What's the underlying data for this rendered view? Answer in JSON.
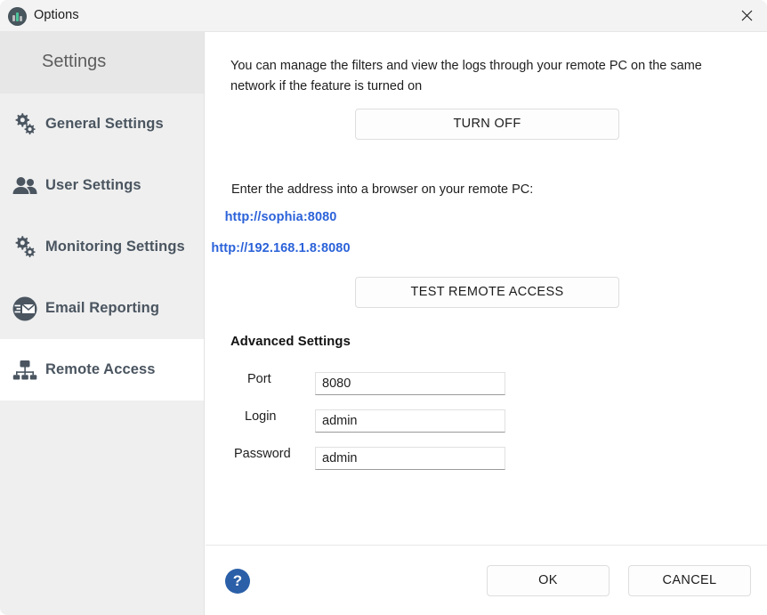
{
  "window": {
    "title": "Options",
    "app_icon": "bar-chart-icon",
    "close_icon": "close-icon"
  },
  "sidebar": {
    "header": "Settings",
    "items": [
      {
        "label": "General Settings",
        "icon": "gears-icon",
        "selected": false
      },
      {
        "label": "User Settings",
        "icon": "users-icon",
        "selected": false
      },
      {
        "label": "Monitoring Settings",
        "icon": "gears-icon",
        "selected": false
      },
      {
        "label": "Email Reporting",
        "icon": "email-icon",
        "selected": false
      },
      {
        "label": "Remote Access",
        "icon": "network-icon",
        "selected": true
      }
    ]
  },
  "main": {
    "intro_text": "You can manage the filters and view the logs through your remote PC on the same network if the feature is turned on",
    "turn_off_label": "TURN OFF",
    "enter_address_label": "Enter the address into a browser on your remote PC:",
    "address_hostname": "http://sophia:8080",
    "address_ip": "http://192.168.1.8:8080",
    "test_remote_access_label": "TEST REMOTE ACCESS",
    "advanced_settings_title": "Advanced Settings",
    "fields": [
      {
        "label": "Port",
        "value": "8080",
        "placeholder": ""
      },
      {
        "label": "Login",
        "value": "admin",
        "placeholder": ""
      },
      {
        "label": "Password",
        "value": "admin",
        "placeholder": ""
      }
    ]
  },
  "footer": {
    "help_label": "?",
    "ok_label": "OK",
    "cancel_label": "CANCEL"
  },
  "colors": {
    "link": "#2b62d9",
    "help_blue": "#2b5fa8",
    "sidebar_bg": "#efefef",
    "sidebar_header_bg": "#e7e7e7",
    "titlebar_bg": "#f3f3f3",
    "nav_label": "#4a5560"
  }
}
